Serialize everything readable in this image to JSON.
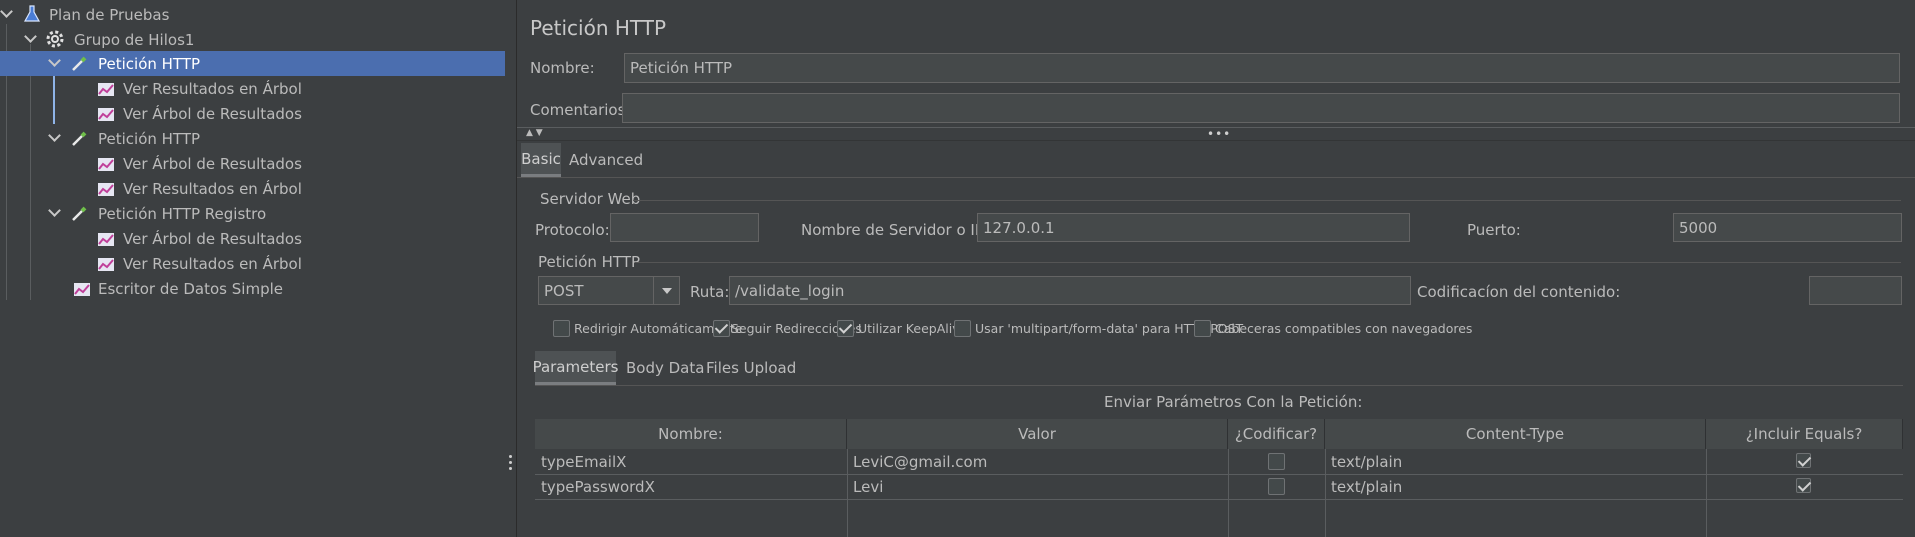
{
  "tree": {
    "items": [
      {
        "label": "Plan de Pruebas",
        "icon": "flask-icon"
      },
      {
        "label": "Grupo de Hilos1",
        "icon": "gear-icon"
      },
      {
        "label": "Petición HTTP",
        "icon": "pipette-icon"
      },
      {
        "label": "Ver Resultados en Árbol",
        "icon": "chart-icon"
      },
      {
        "label": "Ver Árbol de Resultados",
        "icon": "chart-icon"
      },
      {
        "label": "Petición HTTP",
        "icon": "pipette-icon"
      },
      {
        "label": "Ver Árbol de Resultados",
        "icon": "chart-icon"
      },
      {
        "label": "Ver Resultados en Árbol",
        "icon": "chart-icon"
      },
      {
        "label": "Petición HTTP Registro",
        "icon": "pipette-icon"
      },
      {
        "label": "Ver Árbol de Resultados",
        "icon": "chart-icon"
      },
      {
        "label": "Ver Resultados en Árbol",
        "icon": "chart-icon"
      },
      {
        "label": "Escritor de Datos Simple",
        "icon": "chart-icon"
      }
    ]
  },
  "panel": {
    "title": "Petición HTTP",
    "name_label": "Nombre:",
    "name_value": "Petición HTTP",
    "comments_label": "Comentarios",
    "comments_value": "",
    "tabs": {
      "basic": "Basic",
      "advanced": "Advanced"
    },
    "server": {
      "section": "Servidor Web",
      "protocol_label": "Protocolo:",
      "protocol_value": "",
      "host_label": "Nombre de Servidor o IP:",
      "host_value": "127.0.0.1",
      "port_label": "Puerto:",
      "port_value": "5000"
    },
    "request": {
      "section": "Petición HTTP",
      "method": "POST",
      "path_label": "Ruta:",
      "path_value": "/validate_login",
      "encoding_label": "Codificacíon del contenido:",
      "encoding_value": ""
    },
    "options": [
      {
        "label": "Redirigir Automáticamente",
        "checked": false
      },
      {
        "label": "Seguir Redirecciones",
        "checked": true
      },
      {
        "label": "Utilizar KeepAlive",
        "checked": true
      },
      {
        "label": "Usar 'multipart/form-data' para HTTP POST",
        "checked": false
      },
      {
        "label": "Cabeceras compatibles con navegadores",
        "checked": false
      }
    ],
    "subtabs": {
      "parameters": "Parameters",
      "body": "Body Data",
      "files": "Files Upload"
    },
    "params": {
      "caption": "Enviar Parámetros Con la Petición:",
      "headers": [
        "Nombre:",
        "Valor",
        "¿Codificar?",
        "Content-Type",
        "¿Incluir Equals?"
      ],
      "rows": [
        {
          "name": "typeEmailX",
          "value": "LeviC@gmail.com",
          "encode": false,
          "content_type": "text/plain",
          "include_equals": true
        },
        {
          "name": "typePasswordX",
          "value": "Levi",
          "encode": false,
          "content_type": "text/plain",
          "include_equals": true
        }
      ]
    }
  }
}
